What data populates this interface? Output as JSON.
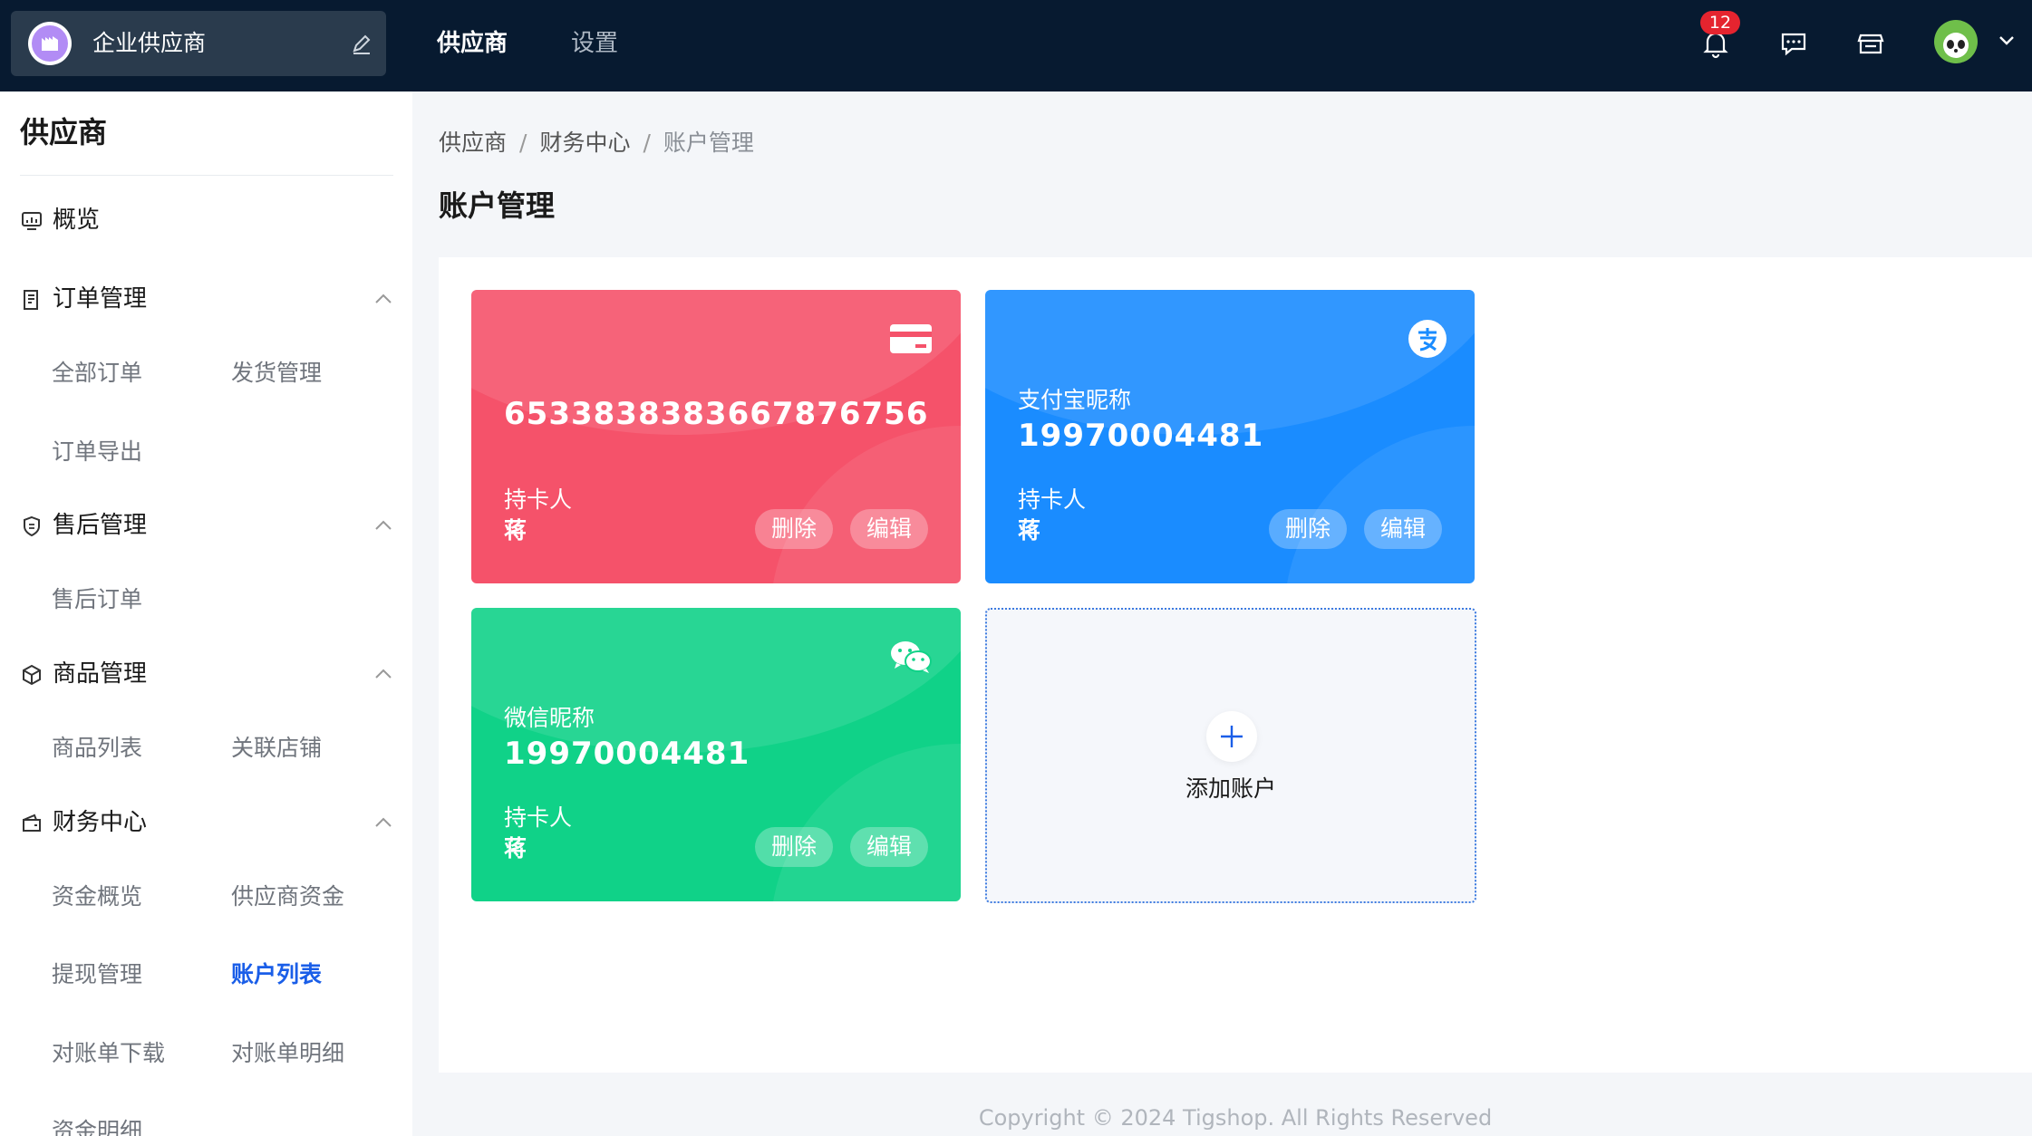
{
  "topbar": {
    "brand_name": "企业供应商",
    "nav": [
      "供应商",
      "设置"
    ],
    "notification_count": "12"
  },
  "sidebar": {
    "title": "供应商",
    "groups": [
      {
        "label": "概览"
      },
      {
        "label": "订单管理",
        "items": [
          "全部订单",
          "发货管理",
          "订单导出"
        ]
      },
      {
        "label": "售后管理",
        "items": [
          "售后订单"
        ]
      },
      {
        "label": "商品管理",
        "items": [
          "商品列表",
          "关联店铺"
        ]
      },
      {
        "label": "财务中心",
        "items": [
          "资金概览",
          "供应商资金",
          "提现管理",
          "账户列表",
          "对账单下载",
          "对账单明细",
          "资金明细"
        ]
      }
    ],
    "active_item": "账户列表"
  },
  "breadcrumb": [
    "供应商",
    "财务中心",
    "账户管理"
  ],
  "page_title": "账户管理",
  "cards": [
    {
      "type": "bank",
      "icon": "credit-card-icon",
      "nickname": "",
      "number": "6533838383667876756",
      "holder_label": "持卡人",
      "holder_name": "蒋",
      "delete_label": "删除",
      "edit_label": "编辑",
      "color": "#f5526a"
    },
    {
      "type": "alipay",
      "icon": "alipay-icon",
      "nickname": "支付宝昵称",
      "number": "19970004481",
      "holder_label": "持卡人",
      "holder_name": "蒋",
      "delete_label": "删除",
      "edit_label": "编辑",
      "color": "#1a8cff"
    },
    {
      "type": "wechat",
      "icon": "wechat-icon",
      "nickname": "微信昵称",
      "number": "19970004481",
      "holder_label": "持卡人",
      "holder_name": "蒋",
      "delete_label": "删除",
      "edit_label": "编辑",
      "color": "#10d288"
    }
  ],
  "add_account_label": "添加账户",
  "footer": "Copyright © 2024 Tigshop. All Rights Reserved",
  "colors": {
    "topbar": "#071a30",
    "accent": "#1a5ee8",
    "badge": "#e5242f"
  }
}
